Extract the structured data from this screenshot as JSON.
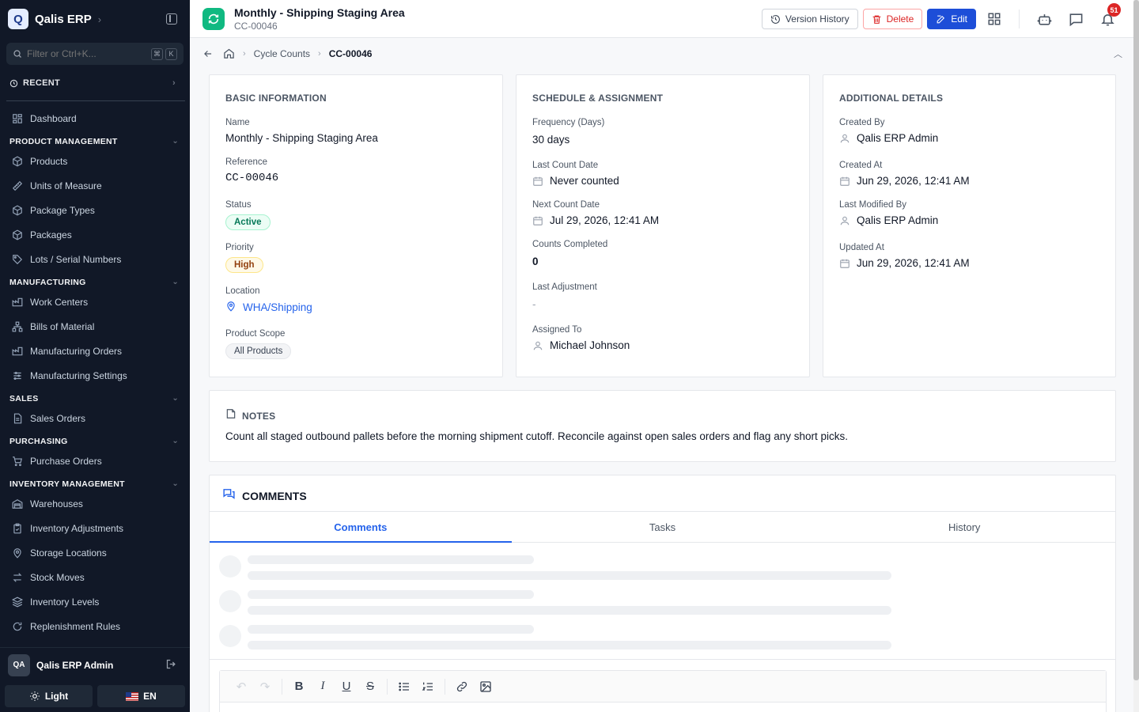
{
  "sidebar": {
    "brand": "Qalis ERP",
    "logo_letter": "Q",
    "search_placeholder": "Filter or Ctrl+K...",
    "kbd": [
      "⌘",
      "K"
    ],
    "recent_label": "RECENT",
    "dashboard": "Dashboard",
    "groups": {
      "product": {
        "label": "PRODUCT MANAGEMENT",
        "items": [
          "Products",
          "Units of Measure",
          "Package Types",
          "Packages",
          "Lots / Serial Numbers"
        ]
      },
      "manufacturing": {
        "label": "MANUFACTURING",
        "items": [
          "Work Centers",
          "Bills of Material",
          "Manufacturing Orders",
          "Manufacturing Settings"
        ]
      },
      "sales": {
        "label": "SALES",
        "items": [
          "Sales Orders"
        ]
      },
      "purchasing": {
        "label": "PURCHASING",
        "items": [
          "Purchase Orders"
        ]
      },
      "inventory": {
        "label": "INVENTORY MANAGEMENT",
        "items": [
          "Warehouses",
          "Inventory Adjustments",
          "Storage Locations",
          "Stock Moves",
          "Inventory Levels",
          "Replenishment Rules"
        ]
      }
    },
    "user": {
      "initials": "QA",
      "name": "Qalis ERP Admin"
    },
    "theme_label": "Light",
    "lang_label": "EN"
  },
  "header": {
    "title": "Monthly - Shipping Staging Area",
    "subtitle": "CC-00046",
    "version_history": "Version History",
    "delete": "Delete",
    "edit": "Edit",
    "notif_count": "51"
  },
  "breadcrumb": {
    "parent": "Cycle Counts",
    "current": "CC-00046"
  },
  "basic": {
    "title": "BASIC INFORMATION",
    "name_label": "Name",
    "name": "Monthly - Shipping Staging Area",
    "ref_label": "Reference",
    "ref": "CC-00046",
    "status_label": "Status",
    "status": "Active",
    "priority_label": "Priority",
    "priority": "High",
    "location_label": "Location",
    "location": "WHA/Shipping",
    "scope_label": "Product Scope",
    "scope": "All Products"
  },
  "schedule": {
    "title": "SCHEDULE & ASSIGNMENT",
    "freq_label": "Frequency (Days)",
    "freq": "30 days",
    "last_label": "Last Count Date",
    "last": "Never counted",
    "next_label": "Next Count Date",
    "next": "Jul 29, 2026, 12:41 AM",
    "counts_label": "Counts Completed",
    "counts": "0",
    "adj_label": "Last Adjustment",
    "adj": "-",
    "assigned_label": "Assigned To",
    "assigned": "Michael Johnson"
  },
  "additional": {
    "title": "ADDITIONAL DETAILS",
    "created_by_label": "Created By",
    "created_by": "Qalis ERP Admin",
    "created_at_label": "Created At",
    "created_at": "Jun 29, 2026, 12:41 AM",
    "modified_by_label": "Last Modified By",
    "modified_by": "Qalis ERP Admin",
    "updated_at_label": "Updated At",
    "updated_at": "Jun 29, 2026, 12:41 AM"
  },
  "notes": {
    "title": "NOTES",
    "text": "Count all staged outbound pallets before the morning shipment cutoff. Reconcile against open sales orders and flag any short picks."
  },
  "comments": {
    "title": "COMMENTS",
    "tabs": [
      "Comments",
      "Tasks",
      "History"
    ],
    "active_tab": "Comments"
  },
  "colors": {
    "accent": "#1d4ed8",
    "danger": "#dc2626",
    "success": "#047857",
    "sidebar_bg": "#111827"
  }
}
